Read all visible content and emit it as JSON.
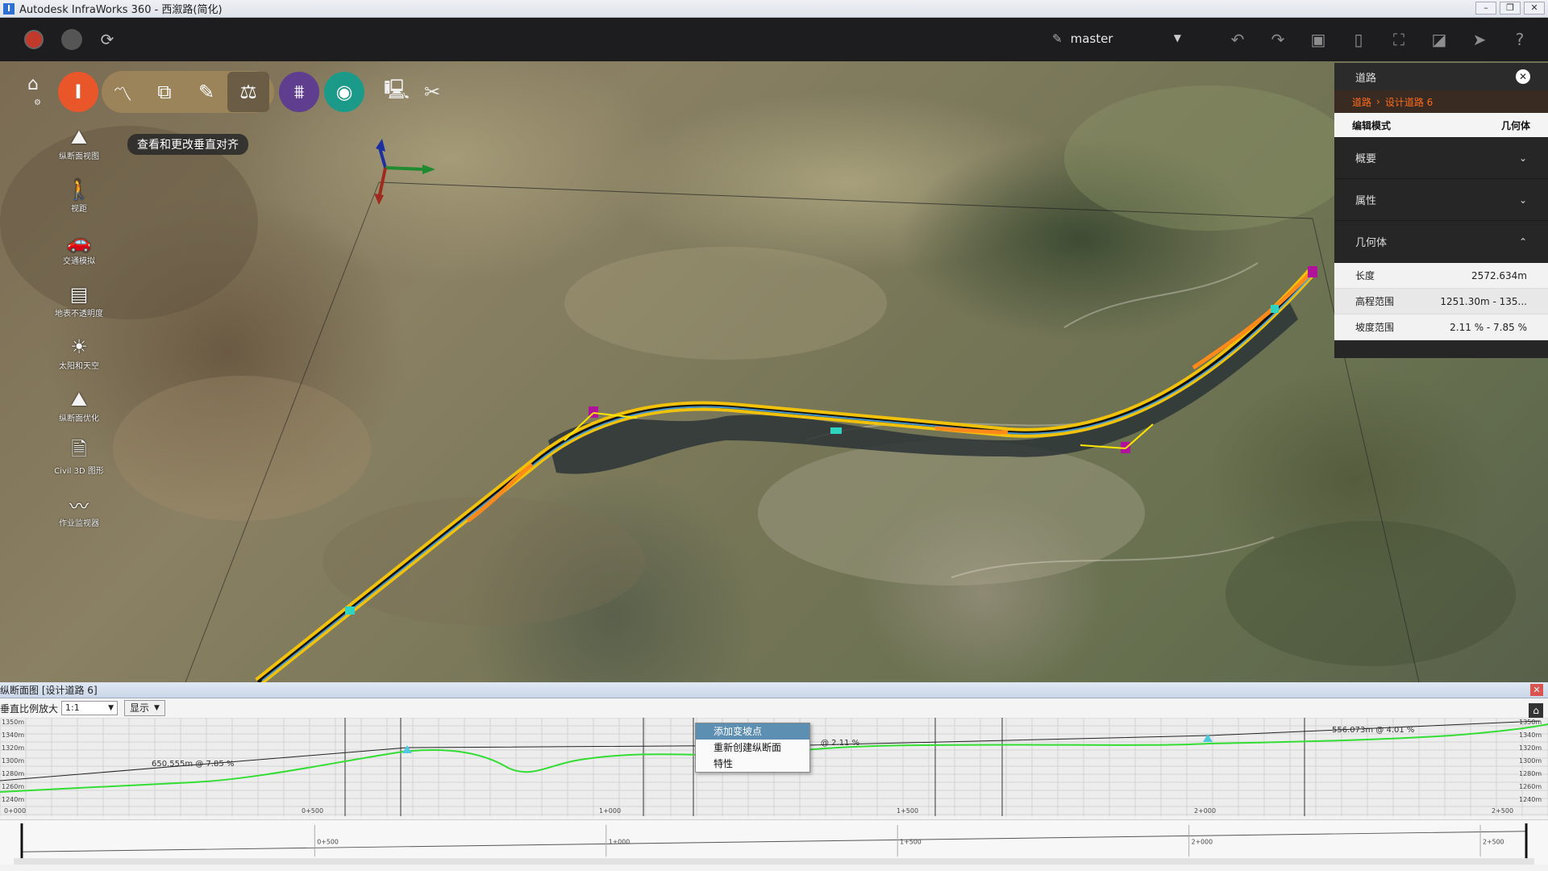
{
  "window": {
    "title": "Autodesk InfraWorks 360 - 西溆路(简化)",
    "controls": [
      "–",
      "❐",
      "✕"
    ]
  },
  "toolbar": {
    "branch": "master",
    "left_icons": [
      "user-icon",
      "cloud-icon",
      "sync-icon"
    ],
    "right_icons": [
      "undo-icon",
      "redo-icon",
      "window-icon",
      "split-icon",
      "fit-icon",
      "select-icon",
      "pointer-icon",
      "help-icon"
    ]
  },
  "modes": {
    "tooltip": "查看和更改垂直对齐",
    "buttons": [
      "road-mode",
      "alignment-mode",
      "copy-mode",
      "draw-mode",
      "balance-mode",
      "bridge-mode",
      "drainage-mode",
      "analysis-mode",
      "tools-mode"
    ]
  },
  "left_tools": [
    {
      "label": "纵断面视图",
      "icon": "profile-view-icon"
    },
    {
      "label": "视距",
      "icon": "sight-distance-icon"
    },
    {
      "label": "交通模拟",
      "icon": "traffic-icon"
    },
    {
      "label": "地表不透明度",
      "icon": "surface-opacity-icon"
    },
    {
      "label": "太阳和天空",
      "icon": "sun-sky-icon"
    },
    {
      "label": "纵断面优化",
      "icon": "profile-optimization-icon"
    },
    {
      "label": "Civil 3D 图形",
      "icon": "civil3d-icon"
    },
    {
      "label": "作业监视器",
      "icon": "job-monitor-icon"
    }
  ],
  "panel": {
    "title": "道路",
    "breadcrumb_root": "道路",
    "breadcrumb_sep": "›",
    "breadcrumb_item": "设计道路 6",
    "mode_label": "编辑模式",
    "mode_value": "几何体",
    "sections": [
      {
        "label": "概要",
        "arrow": "⌄"
      },
      {
        "label": "属性",
        "arrow": "⌄"
      },
      {
        "label": "几何体",
        "arrow": "⌃"
      }
    ],
    "properties": [
      {
        "label": "长度",
        "value": "2572.634m"
      },
      {
        "label": "高程范围",
        "value": "1251.30m - 135..."
      },
      {
        "label": "坡度范围",
        "value": "2.11 % - 7.85 %"
      }
    ]
  },
  "profile": {
    "title": "纵断面图 [设计道路 6]",
    "scale_label": "垂直比例放大",
    "scale_value": "1:1",
    "display_label": "显示",
    "grade_labels": [
      "650.555m @ 7.85 %",
      "@ 2.11 %",
      "556.073m @ 4.01 %"
    ],
    "stations": [
      "0+000",
      "0+500",
      "1+000",
      "1+500",
      "2+000",
      "2+500"
    ],
    "elevations": [
      "1350m",
      "1340m",
      "1320m",
      "1300m",
      "1280m",
      "1260m",
      "1240m"
    ],
    "context_menu": [
      "添加变坡点",
      "重新创建纵断面",
      "特性"
    ]
  }
}
